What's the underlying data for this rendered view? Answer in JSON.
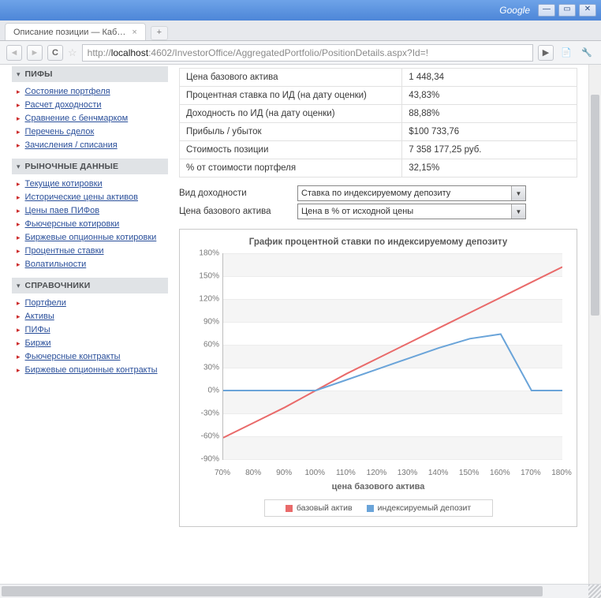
{
  "window": {
    "search_brand": "Google"
  },
  "tabs": {
    "title": "Описание позиции — Каб…"
  },
  "url": {
    "prefix": "http://",
    "host": "localhost",
    "rest": ":4602/InvestorOffice/AggregatedPortfolio/PositionDetails.aspx?Id=!"
  },
  "toolbar": {
    "play": "▶"
  },
  "sidebar": {
    "section1": {
      "title": "ПИФЫ",
      "i1": "Состояние портфеля",
      "i2": "Расчет доходности",
      "i3": "Сравнение с бенчмарком",
      "i4": "Перечень сделок",
      "i5": "Зачисления / списания"
    },
    "section2": {
      "title": "РЫНОЧНЫЕ ДАННЫЕ",
      "i1": "Текущие котировки",
      "i2": "Исторические цены активов",
      "i3": "Цены паев ПИФов",
      "i4": "Фьючерсные котировки",
      "i5": "Биржевые опционные котировки",
      "i6": "Процентные ставки",
      "i7": "Волатильности"
    },
    "section3": {
      "title": "СПРАВОЧНИКИ",
      "i1": "Портфели",
      "i2": "Активы",
      "i3": "ПИФы",
      "i4": "Биржи",
      "i5": "Фьючерсные контракты",
      "i6": "Биржевые опционные контракты"
    }
  },
  "table": {
    "r1": {
      "k": "Цена базового актива",
      "v": "1 448,34"
    },
    "r2": {
      "k": "Процентная ставка по ИД (на дату оценки)",
      "v": "43,83%"
    },
    "r3": {
      "k": "Доходность по ИД (на дату оценки)",
      "v": "88,88%"
    },
    "r4": {
      "k": "Прибыль / убыток",
      "v": "$100 733,76"
    },
    "r5": {
      "k": "Стоимость позиции",
      "v": "7 358 177,25 руб."
    },
    "r6": {
      "k": "% от стоимости портфеля",
      "v": "32,15%"
    }
  },
  "controls": {
    "yield_label": "Вид доходности",
    "yield_value": "Ставка по индексируемому депозиту",
    "price_label": "Цена базового актива",
    "price_value": "Цена в % от исходной цены"
  },
  "chart": {
    "title": "График процентной ставки по индексируемому депозиту",
    "xlabel": "цена базового актива",
    "legend_base": "базовый актив",
    "legend_dep": "индексируемый депозит"
  },
  "chart_data": {
    "type": "line",
    "title": "График процентной ставки по индексируемому депозиту",
    "xlabel": "цена базового актива",
    "ylabel": "",
    "xlim": [
      70,
      180
    ],
    "ylim": [
      -90,
      180
    ],
    "x": [
      70,
      80,
      90,
      100,
      110,
      120,
      130,
      140,
      150,
      160,
      170,
      180
    ],
    "y_ticks": [
      -90,
      -60,
      -30,
      0,
      30,
      60,
      90,
      120,
      150,
      180
    ],
    "series": [
      {
        "name": "базовый актив",
        "color": "#e96a6a",
        "values": [
          -62,
          -42,
          -22,
          0,
          22,
          42,
          62,
          82,
          102,
          122,
          142,
          162
        ]
      },
      {
        "name": "индексируемый депозит",
        "color": "#6aa4d9",
        "values": [
          0,
          0,
          0,
          0,
          14,
          28,
          42,
          56,
          68,
          74,
          0,
          0
        ]
      }
    ]
  }
}
